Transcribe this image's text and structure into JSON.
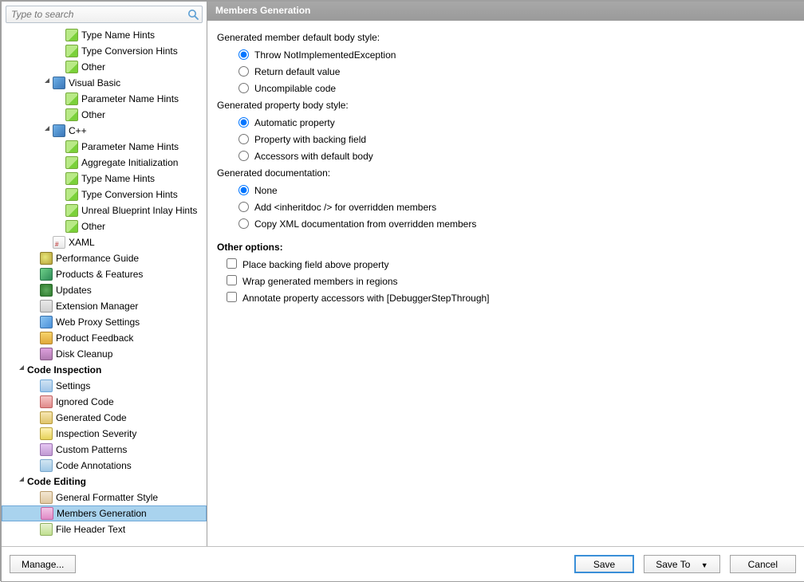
{
  "search": {
    "placeholder": "Type to search"
  },
  "header": {
    "title": "Members Generation"
  },
  "tree": {
    "rows": [
      {
        "indent": 4,
        "icon": "ic-hint",
        "label": "Type Name Hints"
      },
      {
        "indent": 4,
        "icon": "ic-hint",
        "label": "Type Conversion Hints"
      },
      {
        "indent": 4,
        "icon": "ic-hint",
        "label": "Other"
      },
      {
        "indent": 3,
        "expander": "▲",
        "icon": "ic-folder",
        "label": "Visual Basic"
      },
      {
        "indent": 4,
        "icon": "ic-hint",
        "label": "Parameter Name Hints"
      },
      {
        "indent": 4,
        "icon": "ic-hint",
        "label": "Other"
      },
      {
        "indent": 3,
        "expander": "▲",
        "icon": "ic-folder",
        "label": "C++"
      },
      {
        "indent": 4,
        "icon": "ic-hint",
        "label": "Parameter Name Hints"
      },
      {
        "indent": 4,
        "icon": "ic-hint",
        "label": "Aggregate Initialization"
      },
      {
        "indent": 4,
        "icon": "ic-hint",
        "label": "Type Name Hints"
      },
      {
        "indent": 4,
        "icon": "ic-hint",
        "label": "Type Conversion Hints"
      },
      {
        "indent": 4,
        "icon": "ic-hint",
        "label": "Unreal Blueprint Inlay Hints"
      },
      {
        "indent": 4,
        "icon": "ic-hint",
        "label": "Other"
      },
      {
        "indent": 3,
        "icon": "ic-xaml",
        "label": "XAML"
      },
      {
        "indent": 2,
        "icon": "ic-perf",
        "label": "Performance Guide"
      },
      {
        "indent": 2,
        "icon": "ic-prod",
        "label": "Products & Features"
      },
      {
        "indent": 2,
        "icon": "ic-upd",
        "label": "Updates"
      },
      {
        "indent": 2,
        "icon": "ic-ext",
        "label": "Extension Manager"
      },
      {
        "indent": 2,
        "icon": "ic-web",
        "label": "Web Proxy Settings"
      },
      {
        "indent": 2,
        "icon": "ic-mail",
        "label": "Product Feedback"
      },
      {
        "indent": 2,
        "icon": "ic-disk",
        "label": "Disk Cleanup"
      },
      {
        "indent": 1,
        "expander": "▲",
        "label": "Code Inspection",
        "bold": true
      },
      {
        "indent": 2,
        "icon": "ic-set",
        "label": "Settings"
      },
      {
        "indent": 2,
        "icon": "ic-ign",
        "label": "Ignored Code"
      },
      {
        "indent": 2,
        "icon": "ic-gen",
        "label": "Generated Code"
      },
      {
        "indent": 2,
        "icon": "ic-sev",
        "label": "Inspection Severity"
      },
      {
        "indent": 2,
        "icon": "ic-pat",
        "label": "Custom Patterns"
      },
      {
        "indent": 2,
        "icon": "ic-ann",
        "label": "Code Annotations"
      },
      {
        "indent": 1,
        "expander": "▲",
        "label": "Code Editing",
        "bold": true
      },
      {
        "indent": 2,
        "icon": "ic-fmt",
        "label": "General Formatter Style"
      },
      {
        "indent": 2,
        "icon": "ic-mem",
        "label": "Members Generation",
        "selected": true
      },
      {
        "indent": 2,
        "icon": "ic-file",
        "label": "File Header Text"
      }
    ]
  },
  "body": {
    "group1": {
      "label": "Generated member default body style:",
      "options": [
        "Throw NotImplementedException",
        "Return default value",
        "Uncompilable code"
      ],
      "selected": 0
    },
    "group2": {
      "label": "Generated property body style:",
      "options": [
        "Automatic property",
        "Property with backing field",
        "Accessors with default body"
      ],
      "selected": 0
    },
    "group3": {
      "label": "Generated documentation:",
      "options": [
        "None",
        "Add <inheritdoc /> for overridden members",
        "Copy XML documentation from overridden members"
      ],
      "selected": 0
    },
    "other": {
      "heading": "Other options:",
      "checks": [
        "Place backing field above property",
        "Wrap generated members in regions",
        "Annotate property accessors with [DebuggerStepThrough]"
      ]
    }
  },
  "buttons": {
    "manage": "Manage...",
    "save": "Save",
    "saveTo": "Save To",
    "cancel": "Cancel"
  }
}
